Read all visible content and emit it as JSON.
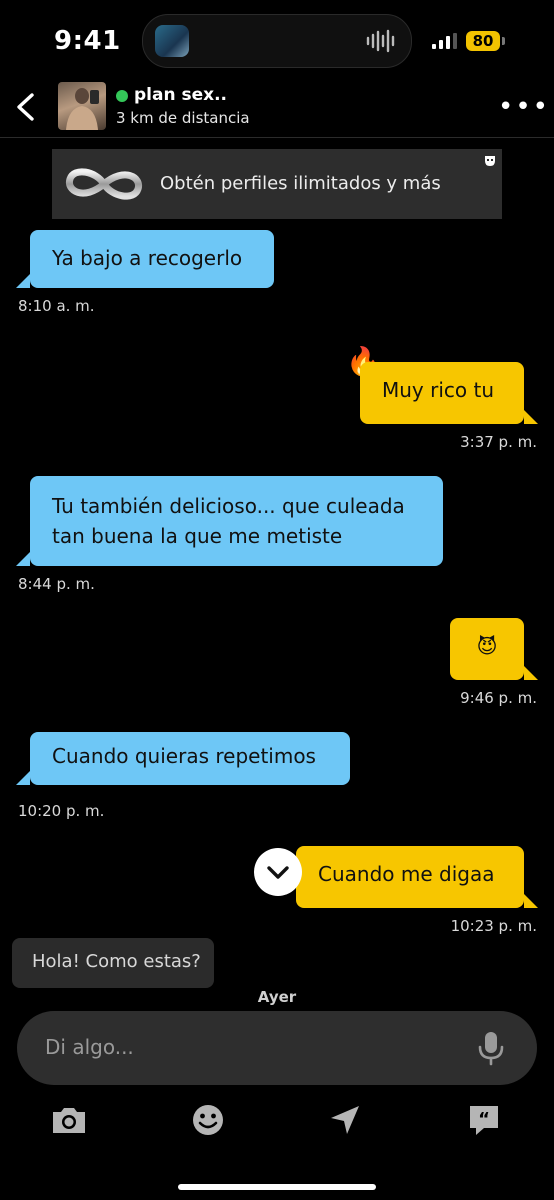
{
  "status_bar": {
    "time": "9:41",
    "battery": "80"
  },
  "header": {
    "name": "plan sex..",
    "distance": "3 km de distancia"
  },
  "promo": {
    "text": "Obtén perfiles ilimitados y más"
  },
  "messages": [
    {
      "text": "Ya bajo a recogerlo",
      "time": "8:10 a. m."
    },
    {
      "text": "Muy rico tu",
      "time": "3:37 p. m.",
      "reaction": "🔥"
    },
    {
      "text": "Tu también delicioso... que culeada tan buena la que me metiste",
      "time": "8:44 p. m."
    },
    {
      "text": "😈",
      "time": "9:46 p. m."
    },
    {
      "text": "Cuando quieras repetimos",
      "time": "10:20 p. m."
    },
    {
      "text": "Cuando me digaa",
      "time": "10:23 p. m."
    }
  ],
  "suggestion": "Hola! Como estas?",
  "day_label": "Ayer",
  "composer": {
    "placeholder": "Di algo..."
  },
  "toolbar": {
    "icons": [
      "camera-icon",
      "emoji-icon",
      "location-icon",
      "saved-phrases-icon"
    ]
  },
  "colors": {
    "incoming": "#6ec7f6",
    "outgoing": "#f7c600",
    "online": "#34c759",
    "background": "#000000"
  }
}
